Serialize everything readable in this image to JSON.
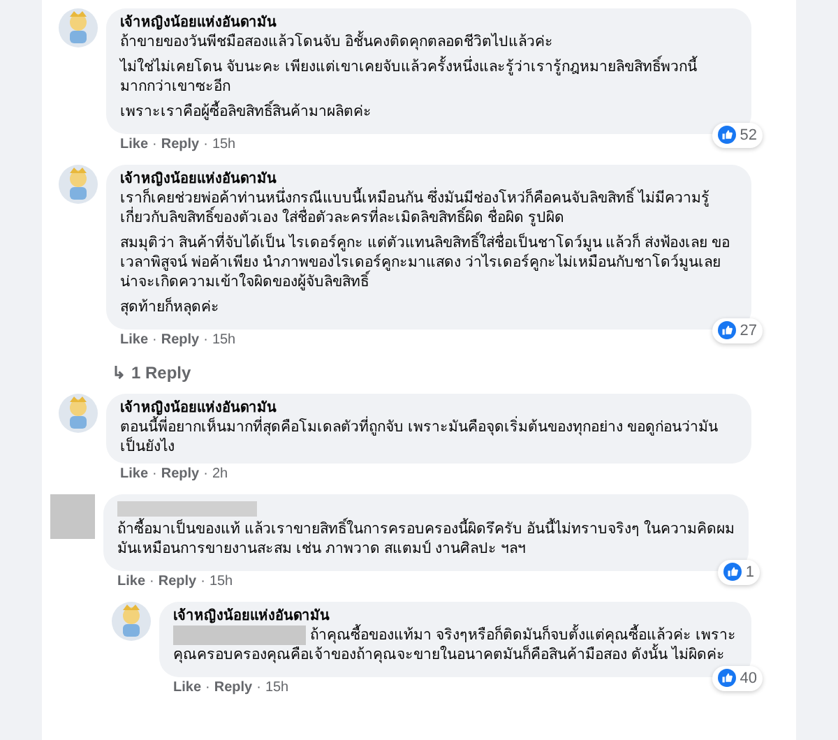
{
  "thread": [
    {
      "kind": "comment",
      "author": "เจ้าหญิงน้อยแห่งอันดามัน",
      "author_hidden": false,
      "avatar_hidden": false,
      "nested": false,
      "mention_hidden": false,
      "paragraphs": [
        "ถ้าขายของวันพีชมือสองแล้วโดนจับ อิชั้นคงติดคุกตลอดชีวิตไปแล้วค่ะ",
        "ไม่ใช่ไม่เคยโดน จับนะคะ เพียงแต่เขาเคยจับแล้วครั้งหนึ่งและรู้ว่าเรารู้กฎหมายลิขสิทธิ์พวกนี้มากกว่าเขาซะอีก",
        "เพราะเราคือผู้ซื้อลิขสิทธิ์สินค้ามาผลิตค่ะ"
      ],
      "actions": [
        {
          "kind": "like",
          "label": "Like"
        },
        {
          "kind": "dot",
          "label": "·"
        },
        {
          "kind": "reply",
          "label": "Reply"
        },
        {
          "kind": "dot",
          "label": "·"
        }
      ],
      "time": "15h",
      "reactions": "52"
    },
    {
      "kind": "comment",
      "author": "เจ้าหญิงน้อยแห่งอันดามัน",
      "author_hidden": false,
      "avatar_hidden": false,
      "nested": false,
      "mention_hidden": false,
      "paragraphs": [
        "เราก็เคยช่วยพ่อค้าท่านหนึ่งกรณีแบบนี้เหมือนกัน ซึ่งมันมีช่องโหว่ก็คือคนจับลิขสิทธิ์ ไม่มีความรู้เกี่ยวกับลิขสิทธิ์ของตัวเอง ใส่ชื่อตัวละครที่ละเมิดลิขสิทธิ์ผิด ชื่อผิด รูปผิด",
        "สมมุติว่า สินค้าที่จับได้เป็น ไรเดอร์คูกะ แต่ตัวแทนลิขสิทธิ์ใส่ชื่อเป็นชาโดว์มูน แล้วก็ ส่งฟ้องเลย ขอเวลาพิสูจน์ พ่อค้าเพียง นำภาพของไรเดอร์คูกะมาแสดง ว่าไรเดอร์คูกะไม่เหมือนกับชาโดว์มูนเลยน่าจะเกิดความเข้าใจผิดของผู้จับลิขสิทธิ์",
        "สุดท้ายก็หลุดค่ะ"
      ],
      "actions": [
        {
          "kind": "like",
          "label": "Like"
        },
        {
          "kind": "dot",
          "label": "·"
        },
        {
          "kind": "reply",
          "label": "Reply"
        },
        {
          "kind": "dot",
          "label": "·"
        }
      ],
      "time": "15h",
      "reactions": "27"
    },
    {
      "kind": "replies_link",
      "icon": "↳",
      "label": "1 Reply"
    },
    {
      "kind": "comment",
      "author": "เจ้าหญิงน้อยแห่งอันดามัน",
      "author_hidden": false,
      "avatar_hidden": false,
      "nested": false,
      "mention_hidden": false,
      "paragraphs": [
        "ตอนนี้พี่อยากเห็นมากที่สุดคือโมเดลตัวที่ถูกจับ เพราะมันคือจุดเริ่มต้นของทุกอย่าง ขอดูก่อนว่ามันเป็นยังไง"
      ],
      "actions": [
        {
          "kind": "like",
          "label": "Like"
        },
        {
          "kind": "dot",
          "label": "·"
        },
        {
          "kind": "reply",
          "label": "Reply"
        },
        {
          "kind": "dot",
          "label": "·"
        }
      ],
      "time": "2h"
    },
    {
      "kind": "comment",
      "author_hidden": true,
      "avatar_hidden": true,
      "nested": false,
      "mention_hidden": false,
      "paragraphs": [
        "ถ้าซื้อมาเป็นของแท้ แล้วเราขายสิทธิ์ในการครอบครองนี้ผิดรึครับ อันนี้ไม่ทราบจริงๆ ในความคิดผมมันเหมือนการขายงานสะสม เช่น ภาพวาด สแตมป์ งานศิลปะ ฯลฯ"
      ],
      "actions": [
        {
          "kind": "like",
          "label": "Like"
        },
        {
          "kind": "dot",
          "label": "·"
        },
        {
          "kind": "reply",
          "label": "Reply"
        },
        {
          "kind": "dot",
          "label": "·"
        }
      ],
      "time": "15h",
      "reactions": "1"
    },
    {
      "kind": "comment",
      "author": "เจ้าหญิงน้อยแห่งอันดามัน",
      "author_hidden": false,
      "avatar_hidden": false,
      "nested": true,
      "mention_hidden": true,
      "paragraphs": [
        "ถ้าคุณซื้อของแท้มา จริงๆหรือก็ติดมันก็จบตั้งแต่คุณซื้อแล้วค่ะ เพราะคุณครอบครองคุณคือเจ้าของถ้าคุณจะขายในอนาคตมันก็คือสินค้ามือสอง ดังนั้น ไม่ผิดค่ะ"
      ],
      "actions": [
        {
          "kind": "like",
          "label": "Like"
        },
        {
          "kind": "dot",
          "label": "·"
        },
        {
          "kind": "reply",
          "label": "Reply"
        },
        {
          "kind": "dot",
          "label": "·"
        }
      ],
      "time": "15h",
      "reactions": "40"
    }
  ]
}
